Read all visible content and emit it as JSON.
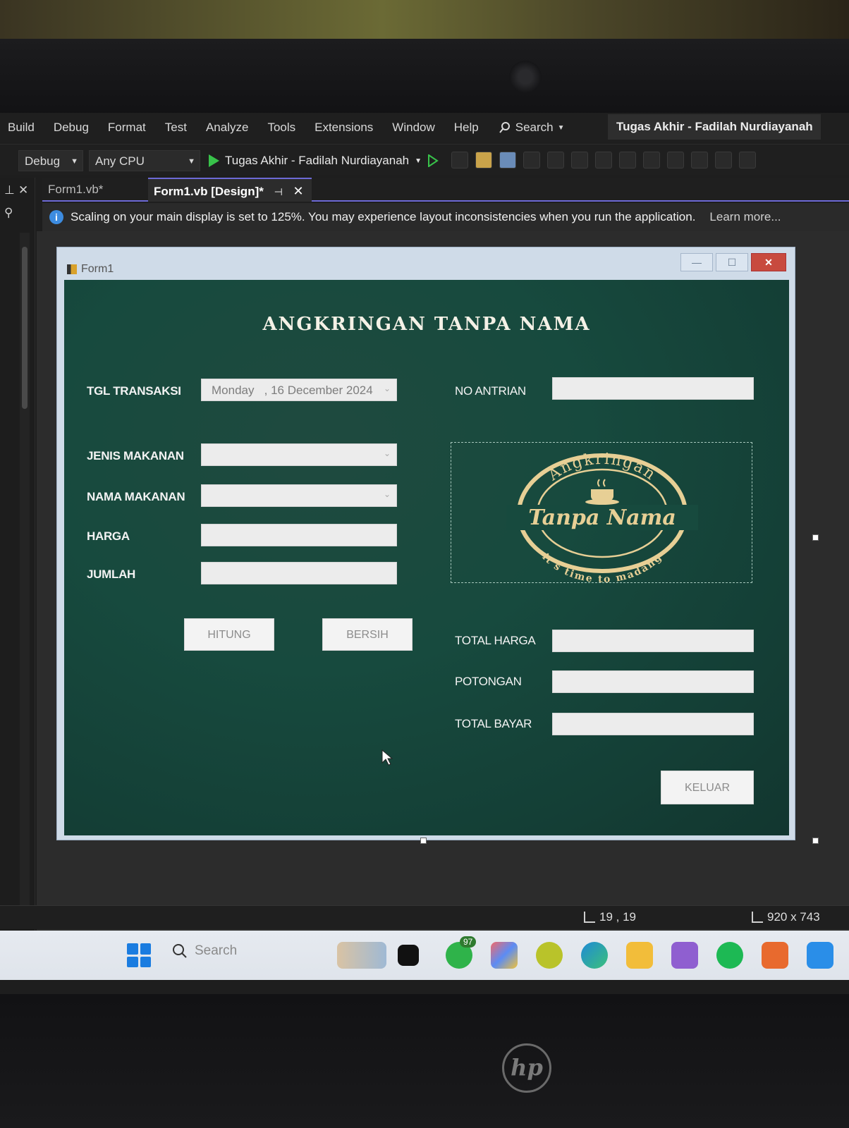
{
  "menubar": {
    "items": [
      "Build",
      "Debug",
      "Format",
      "Test",
      "Analyze",
      "Tools",
      "Extensions",
      "Window",
      "Help"
    ],
    "search_label": "Search",
    "solution_title": "Tugas Akhir - Fadilah Nurdiayanah"
  },
  "toolbar": {
    "config": "Debug",
    "platform": "Any CPU",
    "run_target": "Tugas Akhir - Fadilah Nurdiayanah"
  },
  "tabs": [
    {
      "label": "Form1.vb*",
      "active": false
    },
    {
      "label": "Form1.vb [Design]*",
      "active": true
    }
  ],
  "infobar": {
    "message": "Scaling on your main display is set to 125%. You may experience layout inconsistencies when you run the application.",
    "link": "Learn more..."
  },
  "form": {
    "window_title": "Form1",
    "heading": "ANGKRINGAN TANPA NAMA",
    "labels": {
      "tgl_transaksi": "TGL TRANSAKSI",
      "jenis_makanan": "JENIS MAKANAN",
      "nama_makanan": "NAMA MAKANAN",
      "harga": "HARGA",
      "jumlah": "JUMLAH",
      "no_antrian": "NO ANTRIAN",
      "total_harga": "TOTAL HARGA",
      "potongan": "POTONGAN",
      "total_bayar": "TOTAL BAYAR"
    },
    "date_value": "Monday   , 16 December 2024",
    "buttons": {
      "hitung": "HITUNG",
      "bersih": "BERSIH",
      "keluar": "KELUAR"
    },
    "logo": {
      "top_text": "Angkringan",
      "middle_text": "Tanpa Nama",
      "bottom_text": "it's time to madang",
      "color": "#e7cf95"
    },
    "background_color": "#174a3e"
  },
  "statusbar": {
    "position": "19 , 19",
    "size": "920 x 743"
  },
  "taskbar": {
    "search_placeholder": "Search",
    "whatsapp_badge": "97",
    "logo": "hp"
  }
}
